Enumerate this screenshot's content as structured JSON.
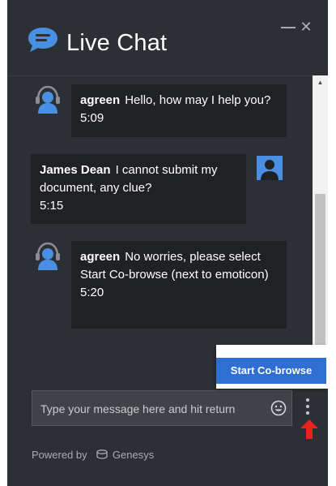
{
  "header": {
    "title": "Live Chat",
    "minimize_glyph": "—",
    "close_glyph": "✕",
    "logo_icon": "chat-bubble-icon"
  },
  "messages": [
    {
      "sender": "agreen",
      "role": "agent",
      "text": "Hello, how may I help you?",
      "time": "5:09"
    },
    {
      "sender": "James Dean",
      "role": "customer",
      "text": "I cannot submit my document, any clue?",
      "time": "5:15"
    },
    {
      "sender": "agreen",
      "role": "agent",
      "text": "No worries, please select Start Co-browse (next to emoticon)",
      "time": "5:20"
    }
  ],
  "cobrowse": {
    "label": "Start Co-browse"
  },
  "composer": {
    "placeholder": "Type your message here and hit return",
    "value": "",
    "emoji_icon": "smiley-icon",
    "menu_icon": "kebab-menu-icon"
  },
  "footer": {
    "powered_by": "Powered by",
    "brand": "Genesys"
  },
  "colors": {
    "window_bg": "#2c2f33",
    "bubble_bg": "#1f2125",
    "accent_blue": "#2f6ed3",
    "avatar_blue": "#4a90e2",
    "arrow_red": "#e8231e"
  }
}
